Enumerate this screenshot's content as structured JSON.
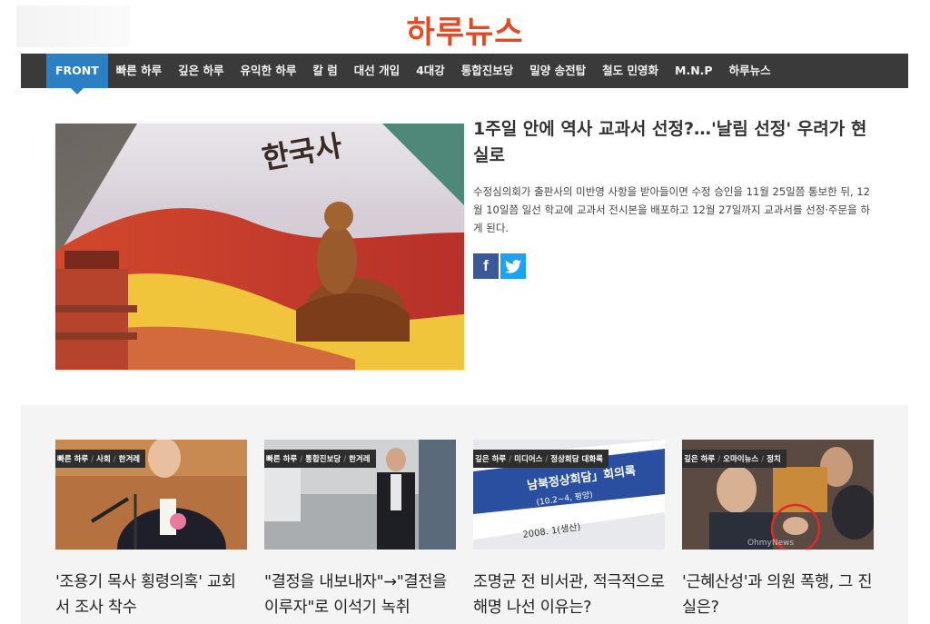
{
  "brand": {
    "logo_text": "하루뉴스"
  },
  "nav": {
    "items": [
      {
        "label": "FRONT"
      },
      {
        "label": "빠른 하루"
      },
      {
        "label": "깊은 하루"
      },
      {
        "label": "유익한 하루"
      },
      {
        "label": "칼 럼"
      },
      {
        "label": "대선 개입"
      },
      {
        "label": "4대강"
      },
      {
        "label": "통합진보당"
      },
      {
        "label": "밀양 송전탑"
      },
      {
        "label": "철도 민영화"
      },
      {
        "label": "M.N.P"
      },
      {
        "label": "하루뉴스"
      }
    ]
  },
  "featured": {
    "title": "1주일 안에 역사 교과서 선정?…'날림 선정' 우려가 현실로",
    "description": "수정심의회가 출판사의 미반영 사항을 받아들이면 수정 승인을 11월 25일쯤 통보한 뒤, 12월 10일쯤 일선 학교에 교과서 전시본을 배포하고 12월 27일까지 교과서를 선정·주문을 하게 된다.",
    "image_text": "한국사",
    "share": {
      "facebook": "f",
      "twitter": "twitter-icon"
    }
  },
  "cards": [
    {
      "tags": [
        "빠른 하루",
        "사회",
        "한겨레"
      ],
      "title": "'조용기 목사 횡령의혹' 교회서 조사 착수"
    },
    {
      "tags": [
        "빠른 하루",
        "통합진보당",
        "한겨레"
      ],
      "title": "\"결정을 내보내자\"→\"결전을 이루자\"로 이석기 녹취"
    },
    {
      "tags": [
        "깊은 하루",
        "미디어스",
        "정상회담 대화록"
      ],
      "title": "조명균 전 비서관, 적극적으로 해명 나선 이유는?",
      "image_text": "남북정상회담」회의록",
      "image_sub": "(10.2~4, 평양)",
      "image_date": "2008. 1(생산)"
    },
    {
      "tags": [
        "깊은 하루",
        "오마이뉴스",
        "정치"
      ],
      "title": "'근혜산성'과 의원 폭행, 그 진실은?",
      "image_watermark": "OhmyNews"
    }
  ],
  "colors": {
    "brand": "#e8471f",
    "nav_bg": "#3a3a3a",
    "nav_active": "#2b7fc3",
    "facebook": "#3b5998",
    "twitter": "#1da1f2"
  }
}
